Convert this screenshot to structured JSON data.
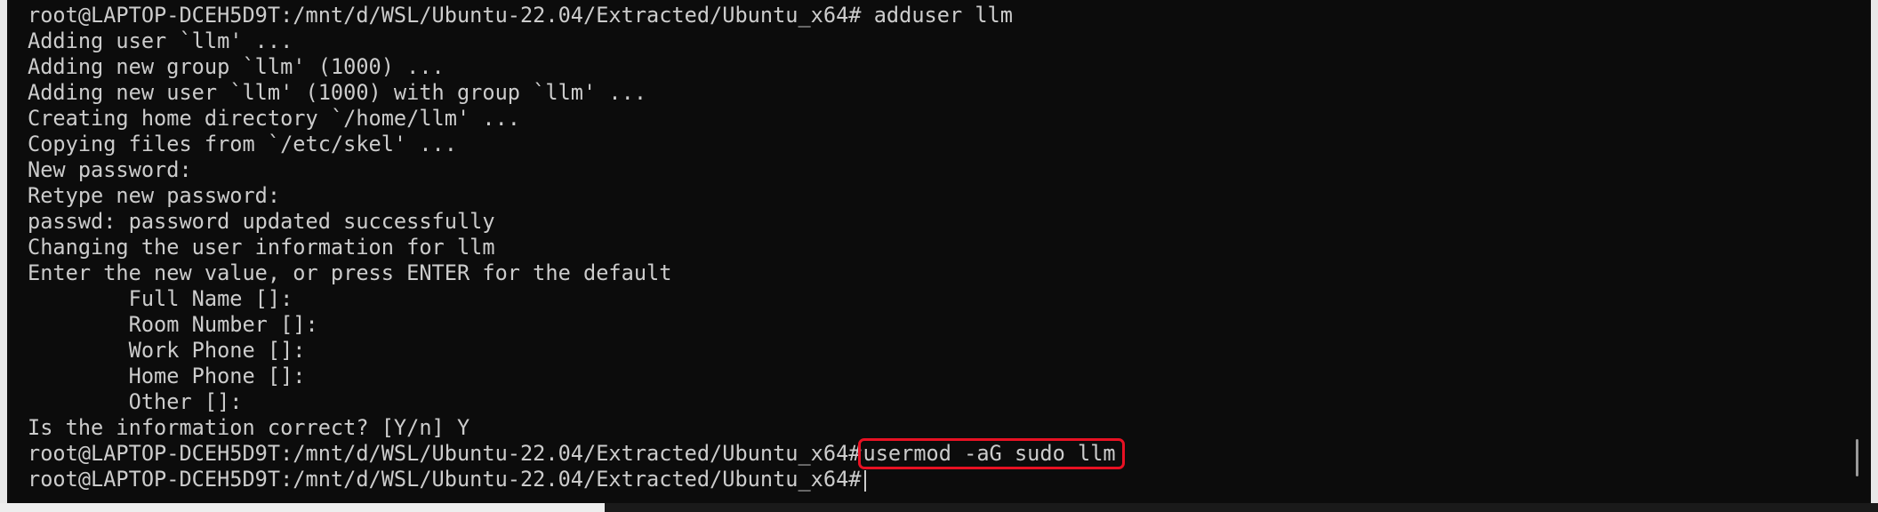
{
  "terminal": {
    "lines": [
      "root@LAPTOP-DCEH5D9T:/mnt/d/WSL/Ubuntu-22.04/Extracted/Ubuntu_x64# adduser llm",
      "Adding user `llm' ...",
      "Adding new group `llm' (1000) ...",
      "Adding new user `llm' (1000) with group `llm' ...",
      "Creating home directory `/home/llm' ...",
      "Copying files from `/etc/skel' ...",
      "New password:",
      "Retype new password:",
      "passwd: password updated successfully",
      "Changing the user information for llm",
      "Enter the new value, or press ENTER for the default",
      "        Full Name []:",
      "        Room Number []:",
      "        Work Phone []:",
      "        Home Phone []:",
      "        Other []:",
      "Is the information correct? [Y/n] Y"
    ],
    "highlighted_line": {
      "prompt": "root@LAPTOP-DCEH5D9T:/mnt/d/WSL/Ubuntu-22.04/Extracted/Ubuntu_x64#",
      "command": "usermod -aG sudo llm"
    },
    "current_line": {
      "prompt": "root@LAPTOP-DCEH5D9T:/mnt/d/WSL/Ubuntu-22.04/Extracted/Ubuntu_x64#",
      "input": ""
    }
  },
  "colors": {
    "background": "#0c0c0c",
    "foreground": "#cccccc",
    "highlight_box": "#e81123"
  }
}
